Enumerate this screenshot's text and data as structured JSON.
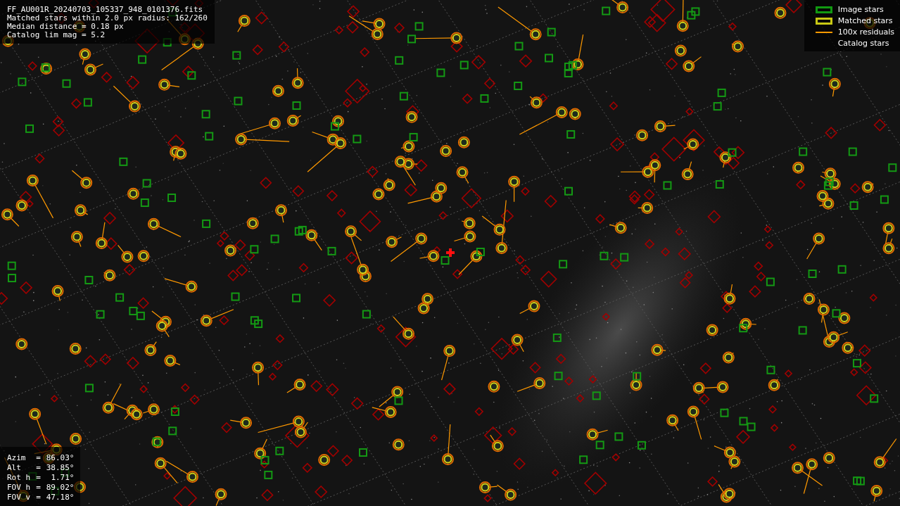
{
  "info_lines": [
    "FF_AU001R_20240703_105337_948_0101376.fits",
    "Matched stars within 2.0 px radius: 162/260",
    "Median distance = 0.18 px",
    "Catalog lim mag = 5.2"
  ],
  "legend": [
    {
      "label": "Image stars",
      "kind": "box",
      "color": "#119911"
    },
    {
      "label": "Matched stars",
      "kind": "box",
      "color": "#c8c814"
    },
    {
      "label": "100x residuals",
      "kind": "line",
      "color": "#ff9900"
    },
    {
      "label": "Catalog stars",
      "kind": "blank"
    }
  ],
  "pointing": [
    {
      "label": "Azim",
      "sep": "=",
      "value": "86.03°"
    },
    {
      "label": "Alt",
      "sep": "=",
      "value": "38.85°"
    },
    {
      "label": "Rot h",
      "sep": "=",
      "value": "1.71°"
    },
    {
      "label": "FOV h",
      "sep": "=",
      "value": "89.02°"
    },
    {
      "label": "FOV v",
      "sep": "=",
      "value": "47.18°"
    }
  ]
}
